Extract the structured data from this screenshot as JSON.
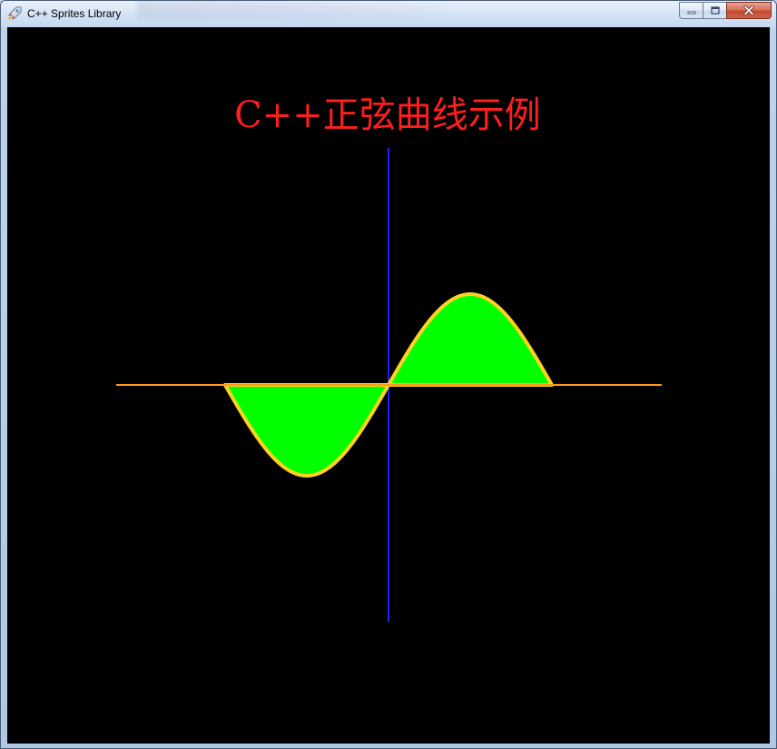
{
  "window": {
    "title": "C++ Sprites Library",
    "icons": {
      "app": "rocket-icon",
      "minimize": "minimize-icon",
      "maximize": "maximize-icon",
      "close": "close-icon"
    }
  },
  "canvas": {
    "background": "#000000",
    "title_text": "C++正弦曲线示例",
    "title_color": "#ff1e1e",
    "colors": {
      "x_axis": "#ff9a1e",
      "y_axis": "#2020ff",
      "curve_stroke": "#ffd21e",
      "curve_fill": "#00ff00"
    }
  }
}
